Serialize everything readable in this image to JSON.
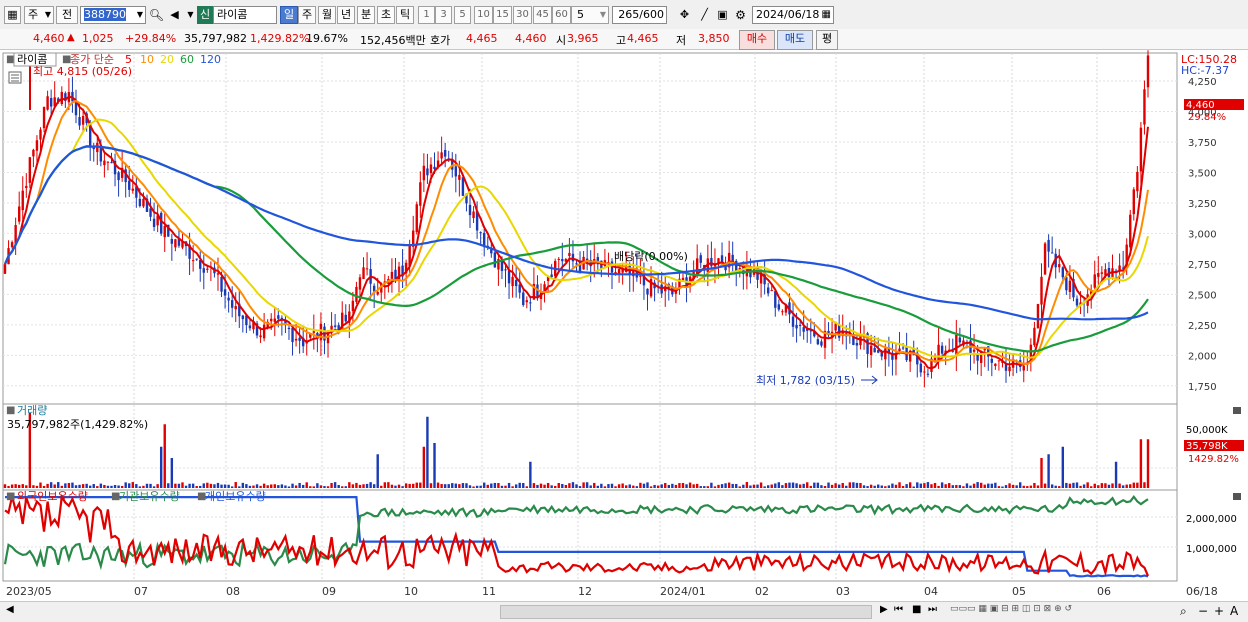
{
  "toolbar": {
    "kind": "주",
    "prev": "전",
    "code": "388790",
    "badge": "신",
    "name": "라이콤",
    "periods": [
      "일",
      "주",
      "월",
      "년",
      "분",
      "초",
      "틱"
    ],
    "num_buttons": [
      "1",
      "3",
      "5",
      "10",
      "15",
      "30",
      "45",
      "60"
    ],
    "count_select": "5",
    "bars": "265",
    "bars_max": "/600",
    "date": "2024/06/18"
  },
  "quote": {
    "price": "4,460",
    "arrow": "▲",
    "change": "1,025",
    "change_pct": "+29.84%",
    "volume": "35,797,982",
    "volume_pct": "1,429.82%",
    "turnover": "19.67%",
    "amount": "152,456백만",
    "hoga_label": "호가",
    "hoga_ask": "4,465",
    "hoga_bid": "4,460",
    "open_label": "시",
    "open": "3,965",
    "high_label": "고",
    "high": "4,465",
    "low_label": "저",
    "low": "3,850",
    "buy": "매수",
    "sell": "매도",
    "avg": "평"
  },
  "main_legend": {
    "name": "라이콤",
    "ma_label": "종가 단순",
    "ma": [
      {
        "p": "5",
        "color": "#e00000"
      },
      {
        "p": "10",
        "color": "#ff8c00"
      },
      {
        "p": "20",
        "color": "#e8d800"
      },
      {
        "p": "60",
        "color": "#199c3a"
      },
      {
        "p": "120",
        "color": "#2255dd"
      }
    ],
    "high_note": "최고 4,815 (05/26)",
    "low_note": "최저 1,782 (03/15)",
    "div_note": "배당락(0.00%)"
  },
  "right_scale": {
    "lc": "LC:150.28",
    "hc": "HC:-7.37",
    "price_tag": "4,460",
    "pct_tag": "29.84%",
    "ticks": [
      "4,250",
      "4,000",
      "3,750",
      "3,500",
      "3,250",
      "3,000",
      "2,750",
      "2,500",
      "2,250",
      "2,000",
      "1,750"
    ]
  },
  "volume_panel": {
    "title": "거래량",
    "value": "35,797,982주(1,429.82%)",
    "tick": "50,000K",
    "tag": "35,798K",
    "pct_tag": "1429.82%"
  },
  "holdings_panel": {
    "legends": [
      "외국인보유수량",
      "기관보유수량",
      "개인보유수량"
    ],
    "colors": [
      "#e00000",
      "#2a8a4a",
      "#2255dd"
    ],
    "ticks": [
      "2,000,000",
      "1,000,000"
    ]
  },
  "x_axis": [
    "2023/05",
    "07",
    "08",
    "09",
    "10",
    "11",
    "12",
    "2024/01",
    "02",
    "03",
    "04",
    "05",
    "06",
    "06/18"
  ],
  "chart_data": {
    "type": "candlestick",
    "title": "라이콤",
    "ylim": [
      1650,
      4480
    ],
    "price_anchors": [
      [
        0,
        2750
      ],
      [
        5,
        3350
      ],
      [
        12,
        4100
      ],
      [
        18,
        4150
      ],
      [
        25,
        3700
      ],
      [
        35,
        3400
      ],
      [
        45,
        3000
      ],
      [
        52,
        2850
      ],
      [
        58,
        2700
      ],
      [
        65,
        2350
      ],
      [
        72,
        2200
      ],
      [
        78,
        2250
      ],
      [
        84,
        2120
      ],
      [
        90,
        2200
      ],
      [
        97,
        2300
      ],
      [
        100,
        2700
      ],
      [
        106,
        2550
      ],
      [
        112,
        2700
      ],
      [
        118,
        3500
      ],
      [
        124,
        3700
      ],
      [
        130,
        3300
      ],
      [
        135,
        2950
      ],
      [
        140,
        2700
      ],
      [
        146,
        2450
      ],
      [
        150,
        2550
      ],
      [
        156,
        2800
      ],
      [
        162,
        2750
      ],
      [
        170,
        2700
      ],
      [
        176,
        2650
      ],
      [
        182,
        2550
      ],
      [
        188,
        2500
      ],
      [
        194,
        2700
      ],
      [
        200,
        2800
      ],
      [
        206,
        2750
      ],
      [
        212,
        2650
      ],
      [
        218,
        2400
      ],
      [
        224,
        2250
      ],
      [
        230,
        2150
      ],
      [
        236,
        2220
      ],
      [
        242,
        2100
      ],
      [
        248,
        2020
      ],
      [
        254,
        1980
      ],
      [
        260,
        1900
      ],
      [
        264,
        2050
      ],
      [
        268,
        2100
      ],
      [
        272,
        2050
      ],
      [
        276,
        1980
      ],
      [
        280,
        1950
      ],
      [
        286,
        1900
      ],
      [
        288,
        1920
      ],
      [
        293,
        2850
      ],
      [
        298,
        2650
      ],
      [
        302,
        2450
      ],
      [
        306,
        2550
      ],
      [
        310,
        2700
      ],
      [
        315,
        2750
      ],
      [
        319,
        3550
      ],
      [
        322,
        4460
      ]
    ],
    "volume_peaks": [
      [
        7,
        1.0
      ],
      [
        44,
        0.55
      ],
      [
        45,
        0.85
      ],
      [
        47,
        0.4
      ],
      [
        105,
        0.45
      ],
      [
        118,
        0.55
      ],
      [
        119,
        0.95
      ],
      [
        121,
        0.6
      ],
      [
        148,
        0.35
      ],
      [
        292,
        0.4
      ],
      [
        294,
        0.45
      ],
      [
        298,
        0.55
      ],
      [
        313,
        0.35
      ],
      [
        320,
        0.65
      ],
      [
        322,
        0.65
      ]
    ],
    "volume_ylim": [
      0,
      55000
    ],
    "holdings_ylim": [
      0,
      2600000
    ]
  }
}
